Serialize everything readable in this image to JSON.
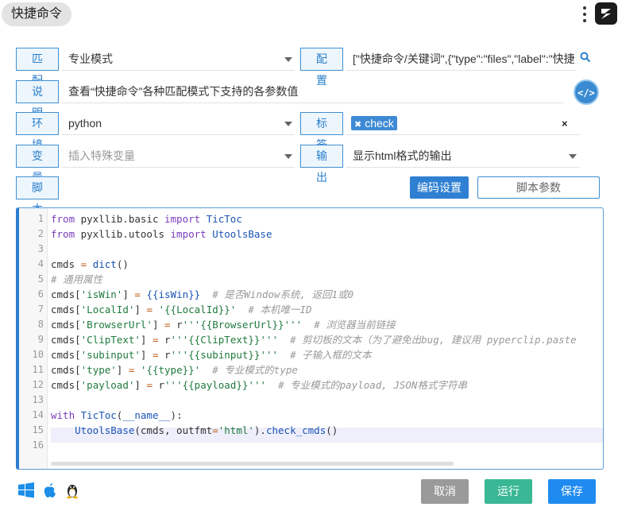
{
  "header": {
    "title": "快捷命令"
  },
  "form": {
    "match": {
      "label": "匹 配",
      "value": "专业模式"
    },
    "config": {
      "label": "配 置",
      "value": "[\"快捷命令/关键词\",{\"type\":\"files\",\"label\":\"快捷"
    },
    "desc": {
      "label": "说 明",
      "value": "查看“快捷命令”各种匹配模式下支持的各参数值"
    },
    "env": {
      "label": "环 境",
      "value": "python"
    },
    "tags": {
      "label": "标 签",
      "items": [
        "check"
      ]
    },
    "vars": {
      "label": "变 量",
      "placeholder": "插入特殊变量"
    },
    "output": {
      "label": "输 出",
      "value": "显示html格式的输出"
    },
    "script": {
      "label": "脚 本"
    }
  },
  "toolbar": {
    "encoding_label": "编码设置",
    "script_args_label": "脚本参数"
  },
  "editor": {
    "line_numbers": [
      "1",
      "2",
      "3",
      "4",
      "5",
      "6",
      "7",
      "8",
      "9",
      "10",
      "11",
      "12",
      "13",
      "14",
      "15",
      "16"
    ],
    "lines": [
      "from pyxllib.basic import TicToc",
      "from pyxllib.utools import UtoolsBase",
      "",
      "cmds = dict()",
      "# 通用属性",
      "cmds['isWin'] = {{isWin}}  # 是否Window系统, 返回1或0",
      "cmds['LocalId'] = '{{LocalId}}'  # 本机唯一ID",
      "cmds['BrowserUrl'] = r'''{{BrowserUrl}}'''  # 浏览器当前链接",
      "cmds['ClipText'] = r'''{{ClipText}}'''  # 剪切板的文本（为了避免出bug, 建议用 pyperclip.paste",
      "cmds['subinput'] = r'''{{subinput}}'''  # 子输入框的文本",
      "cmds['type'] = '{{type}}'  # 专业模式的type",
      "cmds['payload'] = r'''{{payload}}'''  # 专业模式的payload, JSON格式字符串",
      "",
      "with TicToc(__name__):",
      "    UtoolsBase(cmds, outfmt='html').check_cmds()",
      ""
    ]
  },
  "footer": {
    "platforms": [
      "windows-icon",
      "apple-icon",
      "linux-icon"
    ],
    "cancel_label": "取消",
    "run_label": "运行",
    "save_label": "保存"
  }
}
